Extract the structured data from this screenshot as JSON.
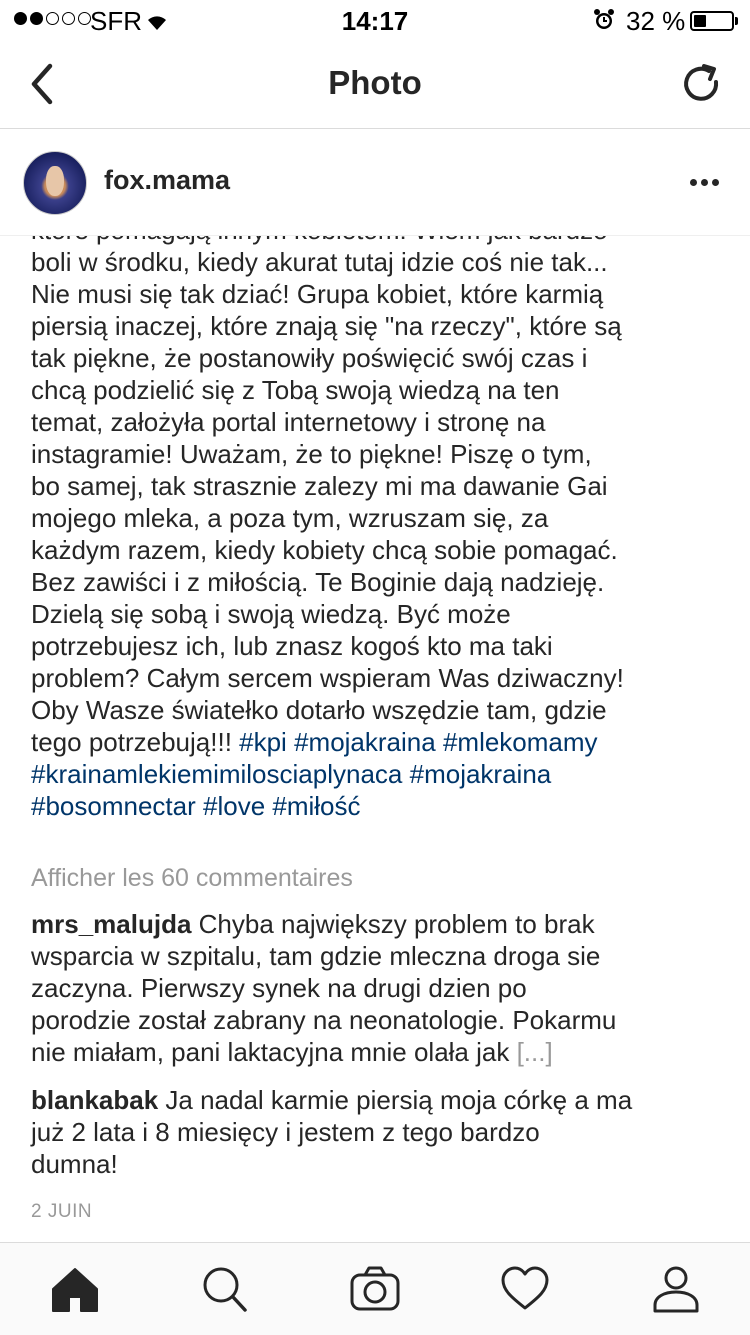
{
  "status_bar": {
    "carrier": "SFR",
    "time": "14:17",
    "battery_percent": "32 %",
    "battery_level": 0.32,
    "signal_bars": 2
  },
  "nav": {
    "title": "Photo",
    "back_icon": "chevron-left-icon",
    "refresh_icon": "refresh-icon"
  },
  "post": {
    "username": "fox.mama",
    "caption_lines": [
      [
        {
          "t": "które pomagają innym kobietom! Wiem jak bardzo"
        }
      ],
      [
        {
          "t": "boli w środku, kiedy akurat tutaj idzie coś nie tak..."
        }
      ],
      [
        {
          "t": "Nie musi się tak dziać! Grupa kobiet, które karmią"
        }
      ],
      [
        {
          "t": "piersią inaczej, które znają się \"na rzeczy\", które są"
        }
      ],
      [
        {
          "t": "tak piękne, że postanowiły poświęcić swój czas i"
        }
      ],
      [
        {
          "t": "chcą podzielić się z Tobą swoją wiedzą na ten"
        }
      ],
      [
        {
          "t": "temat, założyła portal internetowy i stronę na"
        }
      ],
      [
        {
          "t": "instagramie! Uważam, że to piękne! Piszę o tym,"
        }
      ],
      [
        {
          "t": "bo samej, tak strasznie zalezy mi ma dawanie Gai"
        }
      ],
      [
        {
          "t": "mojego mleka, a poza tym, wzruszam się, za"
        }
      ],
      [
        {
          "t": "każdym razem, kiedy kobiety chcą sobie pomagać."
        }
      ],
      [
        {
          "t": "Bez zawiści i z miłością. Te Boginie  dają nadzieję."
        }
      ],
      [
        {
          "t": "Dzielą się sobą i swoją wiedzą. Być może"
        }
      ],
      [
        {
          "t": "potrzebujesz ich, lub znasz kogoś kto ma taki"
        }
      ],
      [
        {
          "t": "problem? Całym sercem wspieram Was dziwaczny!"
        }
      ],
      [
        {
          "t": "Oby Wasze światełko dotarło wszędzie tam, gdzie"
        }
      ],
      [
        {
          "t": "tego potrzebują!!! "
        },
        {
          "t": "#kpi",
          "tag": true
        },
        {
          "t": " "
        },
        {
          "t": "#mojakraina",
          "tag": true
        },
        {
          "t": " "
        },
        {
          "t": "#mlekomamy",
          "tag": true
        }
      ],
      [
        {
          "t": "#krainamlekiemimilosciaplynaca",
          "tag": true
        },
        {
          "t": " "
        },
        {
          "t": "#mojakraina",
          "tag": true
        }
      ],
      [
        {
          "t": "#bosomnectar",
          "tag": true
        },
        {
          "t": " "
        },
        {
          "t": "#love",
          "tag": true
        },
        {
          "t": " "
        },
        {
          "t": "#miłość",
          "tag": true
        }
      ]
    ],
    "view_comments": "Afficher les 60 commentaires",
    "comments": [
      {
        "user": "mrs_malujda",
        "lines": [
          " Chyba największy problem to brak",
          "wsparcia w szpitalu, tam gdzie mleczna droga sie",
          "zaczyna. Pierwszy synek  na drugi dzien po",
          "porodzie został zabrany na neonatologie. Pokarmu",
          "nie miałam, pani laktacyjna mnie olała jak "
        ],
        "more": "[...]"
      },
      {
        "user": "blankabak",
        "lines": [
          " Ja nadal karmie piersią moja córkę a ma",
          "już 2 lata i 8 miesięcy i jestem z tego bardzo",
          "dumna!"
        ],
        "more": ""
      }
    ],
    "date": "2 JUIN"
  },
  "tab_bar": {
    "tabs": [
      {
        "name": "home-icon",
        "active": true
      },
      {
        "name": "search-icon",
        "active": false
      },
      {
        "name": "camera-icon",
        "active": false
      },
      {
        "name": "heart-icon",
        "active": false
      },
      {
        "name": "profile-icon",
        "active": false
      }
    ]
  },
  "colors": {
    "hashtag": "#003569",
    "muted": "#999999",
    "text": "#262626"
  }
}
